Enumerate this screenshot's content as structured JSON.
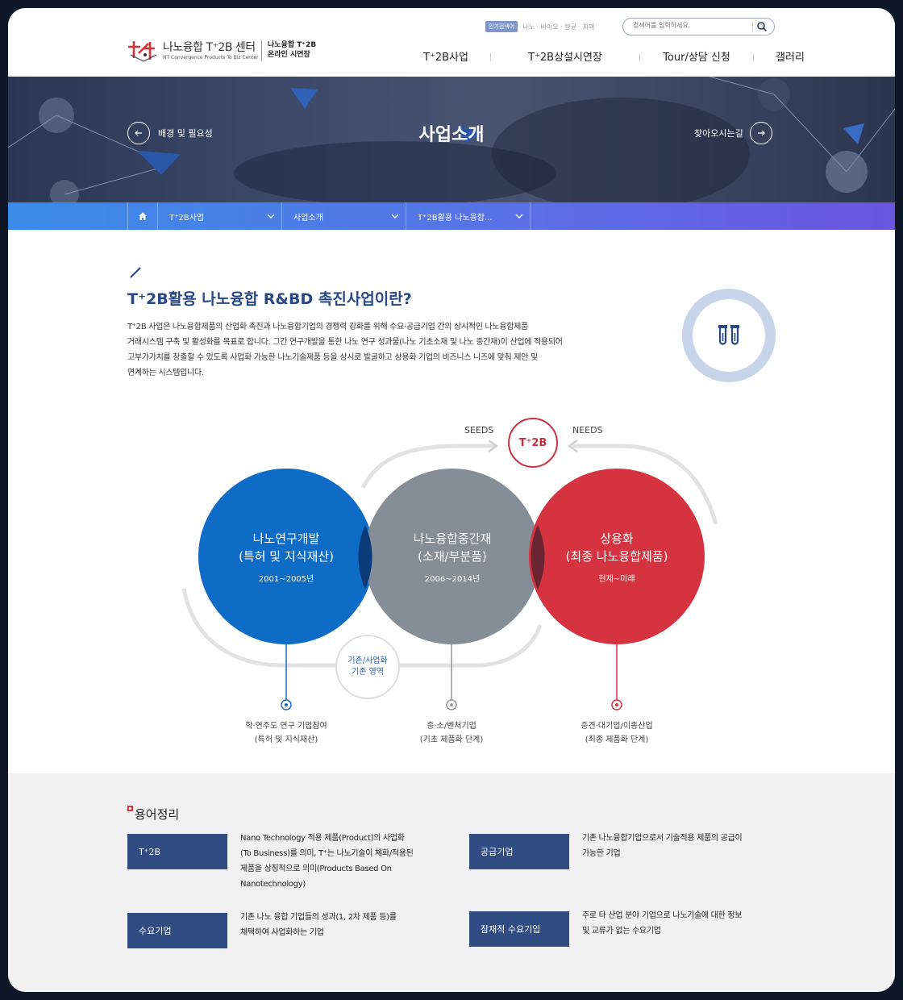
{
  "header": {
    "logo_title": "나노융합 T⁺2B 센터",
    "logo_sub": "NT Convergence Products To Biz Center",
    "logo_right_line1": "나노융합 T⁺2B",
    "logo_right_line2": "온라인 시연장",
    "hot_badge": "인기검색어",
    "hot_words": "나노 · 바이오 · 향균 · 치매",
    "search_placeholder": "검색어를 입력하세요.",
    "nav": [
      "T⁺2B사업",
      "T⁺2B상설시연장",
      "Tour/상담 신청",
      "갤러리"
    ]
  },
  "hero": {
    "title": "사업소개",
    "prev_label": "배경 및 필요성",
    "next_label": "찾아오시는길"
  },
  "breadcrumb": {
    "items": [
      "T⁺2B사업",
      "사업소개",
      "T⁺2B활용 나노융합..."
    ]
  },
  "intro": {
    "title": "T⁺2B활용 나노융합 R&BD 촉진사업이란?",
    "lines": [
      "T⁺2B 사업은 나노융합제품의 산업화 촉진과 나노융합기업의 경쟁력 강화를 위해 수요·공급기업 간의 상시적인 나노융합제품",
      "거래시스템 구축 및 활성화를 목표로 합니다. 그간 연구개발을 통한 나노 연구 성과물(나노 기초소재 및 나노 중간재)이 산업에 적용되어",
      "고부가가치를 창출할 수 있도록 사업화 가능한 나노기술제품 등을 상시로 발굴하고 상용화 기업의 비즈니스 니즈에 맞춰 제안 및",
      "연계하는 시스템입니다."
    ]
  },
  "diagram": {
    "seeds": "SEEDS",
    "needs": "NEEDS",
    "badge": "T⁺2B",
    "existing_line1": "기존/사업화",
    "existing_line2": "기존 영역",
    "circles": [
      {
        "line1": "나노연구개발",
        "line2": "(특허 및 지식재산)",
        "period": "2001~2005년",
        "color": "#0f6cc6"
      },
      {
        "line1": "나노융합중간재",
        "line2": "(소재/부분품)",
        "period": "2006~2014년",
        "color": "#858d97"
      },
      {
        "line1": "상용화",
        "line2": "(최종 나노융합제품)",
        "period": "현재~미래",
        "color": "#d4333f"
      }
    ],
    "bottom": [
      {
        "line1": "학·연주도 연구 기업참여",
        "line2": "(특허 및 지식재산)"
      },
      {
        "line1": "중·소/벤처기업",
        "line2": "(기초 제품화 단계)"
      },
      {
        "line1": "중견·대기업/이종산업",
        "line2": "(최종 제품화 단계)"
      }
    ]
  },
  "glossary": {
    "title": "용어정리",
    "terms": [
      {
        "term": "T⁺2B",
        "desc": [
          "Nano Technology 적용 제품(Product)의 사업화",
          "(To Business)를 의미, T⁺는 나노기술이 체화/적용된",
          "제품을 상징적으로 의미(Products Based On",
          "Nanotechnology)"
        ]
      },
      {
        "term": "공급기업",
        "desc": [
          "기존 나노융합기업으로서 기술적용 제품의 공급이",
          "가능한 기업"
        ]
      },
      {
        "term": "수요기업",
        "desc": [
          "기존 나노 융합 기업들의 성과(1, 2차 제품 등)를",
          "채택하여 사업화하는 기업"
        ]
      },
      {
        "term": "잠재적 수요기업",
        "desc": [
          "주로 타 산업 분야 기업으로 나노기술에 대한 정보",
          "및 교류가 없는 수요기업"
        ]
      }
    ]
  },
  "colors": {
    "navy": "#284785",
    "red": "#d4333f",
    "blue": "#0f6cc6",
    "gray": "#858d97",
    "term_bg": "#2f4d83"
  },
  "icons": [
    "logo-mark-icon",
    "search-icon",
    "arrow-left-icon",
    "arrow-right-icon",
    "home-icon",
    "chevron-down-icon",
    "test-tube-icon"
  ]
}
